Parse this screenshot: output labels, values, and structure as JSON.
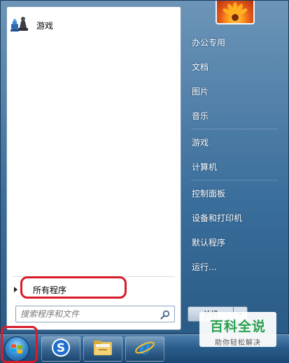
{
  "left_panel": {
    "pinned": [
      {
        "label": "游戏",
        "icon": "games-icon"
      }
    ],
    "all_programs_label": "所有程序",
    "search": {
      "placeholder": "搜索程序和文件"
    }
  },
  "right_panel": {
    "items": [
      {
        "label": "办公专用"
      },
      {
        "label": "文档"
      },
      {
        "label": "图片"
      },
      {
        "label": "音乐"
      },
      {
        "label": "游戏"
      },
      {
        "label": "计算机"
      },
      {
        "label": "控制面板"
      },
      {
        "label": "设备和打印机"
      },
      {
        "label": "默认程序"
      },
      {
        "label": "运行..."
      }
    ],
    "shutdown_label": "关机"
  },
  "taskbar": {
    "buttons": [
      {
        "icon": "sogou-icon"
      },
      {
        "icon": "file-explorer-icon"
      },
      {
        "icon": "internet-explorer-icon"
      }
    ]
  },
  "watermark": {
    "title": "百科全说",
    "subtitle": "助你轻松解决"
  },
  "colors": {
    "highlight_ring": "#d81c2a",
    "watermark_green": "#2aa14e"
  }
}
